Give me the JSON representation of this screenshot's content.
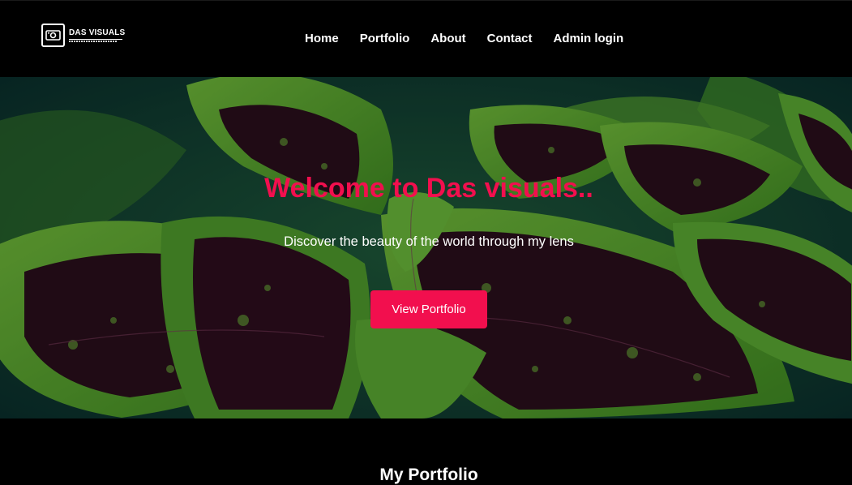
{
  "brand": {
    "logo_icon": "camera-icon",
    "name": "DAS VISUALS"
  },
  "nav": {
    "items": [
      {
        "label": "Home"
      },
      {
        "label": "Portfolio"
      },
      {
        "label": "About"
      },
      {
        "label": "Contact"
      },
      {
        "label": "Admin login"
      }
    ]
  },
  "hero": {
    "title": "Welcome to Das visuals..",
    "subtitle": "Discover the beauty of the world through my lens",
    "cta_label": "View Portfolio",
    "background": "coleus-leaves-photo"
  },
  "portfolio": {
    "heading": "My Portfolio"
  },
  "colors": {
    "accent": "#f20f4e",
    "background": "#000000",
    "text": "#ffffff"
  }
}
